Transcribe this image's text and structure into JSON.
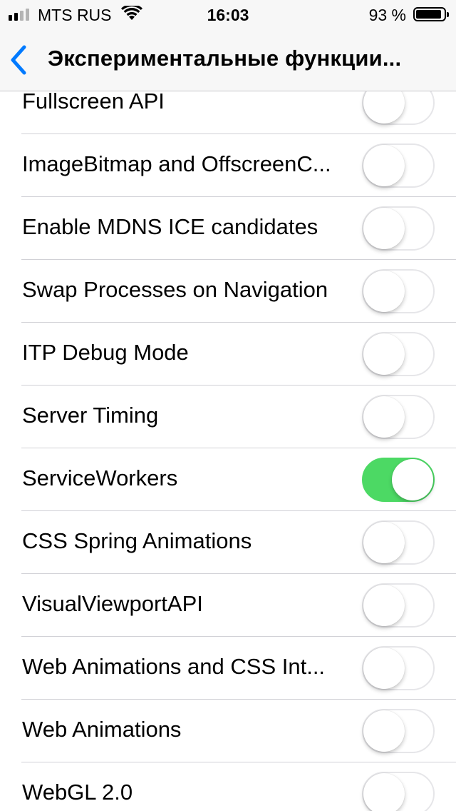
{
  "status_bar": {
    "carrier": "MTS RUS",
    "time": "16:03",
    "battery_percent": "93 %",
    "battery_level": 0.93,
    "signal_bars_filled": 2,
    "signal_bars_total": 4,
    "icons": [
      "signal-icon",
      "wifi-icon",
      "battery-icon"
    ]
  },
  "nav": {
    "title": "Экспериментальные функции...",
    "back_icon": "chevron-left-icon",
    "accent_color": "#007aff"
  },
  "colors": {
    "toggle_on": "#4cd964",
    "toggle_off_border": "#e6e6e9",
    "divider": "#d1d1d6"
  },
  "settings": [
    {
      "label": "Fullscreen API",
      "enabled": false
    },
    {
      "label": "ImageBitmap and OffscreenC...",
      "enabled": false
    },
    {
      "label": "Enable MDNS ICE candidates",
      "enabled": false
    },
    {
      "label": "Swap Processes on Navigation",
      "enabled": false
    },
    {
      "label": "ITP Debug Mode",
      "enabled": false
    },
    {
      "label": "Server Timing",
      "enabled": false
    },
    {
      "label": "ServiceWorkers",
      "enabled": true
    },
    {
      "label": "CSS Spring Animations",
      "enabled": false
    },
    {
      "label": "VisualViewportAPI",
      "enabled": false
    },
    {
      "label": "Web Animations and CSS Int...",
      "enabled": false
    },
    {
      "label": "Web Animations",
      "enabled": false
    },
    {
      "label": "WebGL 2.0",
      "enabled": false
    }
  ]
}
